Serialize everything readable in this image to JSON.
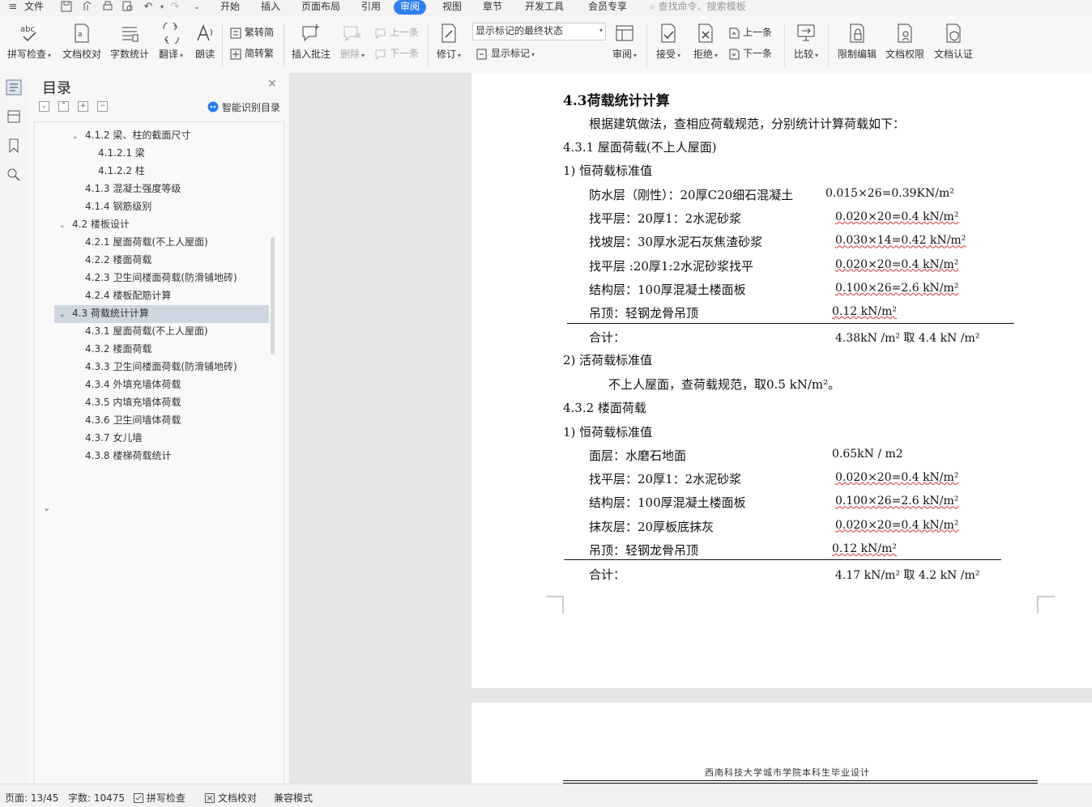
{
  "menu": {
    "file": "文件",
    "tabs": [
      "开始",
      "插入",
      "页面布局",
      "引用",
      "审阅",
      "视图",
      "章节",
      "开发工具",
      "会员专享"
    ],
    "active_tab": "审阅",
    "search_placeholder": "查找命令、搜索模板"
  },
  "ribbon": {
    "spell_check": "拼写检查",
    "doc_proof": "文档校对",
    "word_count": "字数统计",
    "translate": "翻译",
    "read_aloud": "朗读",
    "trad_to_simp": "繁转简",
    "simp_to_trad": "简转繁",
    "insert_comment": "插入批注",
    "delete": "删除",
    "prev_comment": "上一条",
    "next_comment": "下一条",
    "revise": "修订",
    "markup_mode": "显示标记的最终状态",
    "show_markup": "显示标记",
    "review": "审阅",
    "accept": "接受",
    "reject": "拒绝",
    "prev_change": "上一条",
    "next_change": "下一条",
    "compare": "比较",
    "restrict_edit": "限制编辑",
    "doc_permission": "文档权限",
    "doc_auth": "文档认证"
  },
  "toc": {
    "title": "目录",
    "smart_detect": "智能识别目录",
    "items": [
      {
        "label": "4.1.2  梁、柱的截面尺寸",
        "level": 2,
        "chevron": "⌄"
      },
      {
        "label": "4.1.2.1 梁",
        "level": 3
      },
      {
        "label": "4.1.2.2  柱",
        "level": 3
      },
      {
        "label": "4.1.3  混凝土强度等级",
        "level": 2
      },
      {
        "label": "4.1.4  钢筋级别",
        "level": 2
      },
      {
        "label": "4.2  楼板设计",
        "level": 1,
        "chevron": "⌄"
      },
      {
        "label": "4.2.1  屋面荷载(不上人屋面)",
        "level": 2
      },
      {
        "label": "4.2.2  楼面荷载",
        "level": 2
      },
      {
        "label": "4.2.3  卫生间楼面荷载(防滑铺地砖)",
        "level": 2
      },
      {
        "label": "4.2.4  楼板配筋计算",
        "level": 2
      },
      {
        "label": "4.3 荷载统计计算",
        "level": 1,
        "chevron": "⌄",
        "selected": true
      },
      {
        "label": "4.3.1  屋面荷载(不上人屋面)",
        "level": 2
      },
      {
        "label": "4.3.2  楼面荷载",
        "level": 2
      },
      {
        "label": "4.3.3  卫生间楼面荷载(防滑铺地砖)",
        "level": 2
      },
      {
        "label": "4.3.4  外填充墙体荷载",
        "level": 2
      },
      {
        "label": "4.3.5  内填充墙体荷载",
        "level": 2
      },
      {
        "label": "4.3.6  卫生间墙体荷载",
        "level": 2
      },
      {
        "label": "4.3.7  女儿墙",
        "level": 2
      },
      {
        "label": "4.3.8  楼梯荷载统计",
        "level": 2
      }
    ]
  },
  "document": {
    "heading": "4.3荷载统计计算",
    "intro": "根据建筑做法，查相应荷载规范，分别统计计算荷载如下：",
    "sec1_title": "4.3.1  屋面荷载(不上人屋面)",
    "sec1_dead_title": "1) 恒荷载标准值",
    "sec1_rows": [
      {
        "name": "防水层（刚性）：20厚C20细石混凝土",
        "value": "0.015×26=0.39KN/m²",
        "wavy": false
      },
      {
        "name": "找平层：20厚1：2水泥砂浆",
        "value": "0.020×20=0.4 kN/m²",
        "wavy": true
      },
      {
        "name": "找坡层：30厚水泥石灰焦渣砂浆",
        "value": "0.030×14=0.42 kN/m²",
        "wavy": true
      },
      {
        "name": "找平层 :20厚1:2水泥砂浆找平",
        "value": "0.020×20=0.4 kN/m²",
        "wavy": true
      },
      {
        "name": "结构层：100厚混凝土楼面板",
        "value": "0.100×26=2.6 kN/m²",
        "wavy": true
      },
      {
        "name": "吊顶：轻钢龙骨吊顶",
        "value": "0.12 kN/m²",
        "wavy": true
      }
    ],
    "sec1_total_label": "合计：",
    "sec1_total_value": "4.38kN /m²  取 4.4 kN /m²",
    "sec1_live_title": "2) 活荷载标准值",
    "sec1_live_text": "不上人屋面，查荷载规范，取0.5 kN/m²。",
    "sec2_title": "4.3.2  楼面荷载",
    "sec2_dead_title": "1) 恒荷载标准值",
    "sec2_rows": [
      {
        "name": "面层：水磨石地面",
        "value": "0.65kN / m2",
        "wavy": false
      },
      {
        "name": "找平层：20厚1：2水泥砂浆",
        "value": "0.020×20=0.4 kN/m²",
        "wavy": true
      },
      {
        "name": "结构层：100厚混凝土楼面板",
        "value": "0.100×26=2.6 kN/m²",
        "wavy": true
      },
      {
        "name": "抹灰层：20厚板底抹灰",
        "value": "0.020×20=0.4 kN/m²",
        "wavy": true
      },
      {
        "name": "吊顶：轻钢龙骨吊顶",
        "value": "0.12 kN/m²",
        "wavy": true
      }
    ],
    "sec2_total_label": "合计：",
    "sec2_total_value": "4.17  kN/m² 取 4.2 kN /m²",
    "page2_header": "西南科技大学城市学院本科生毕业设计"
  },
  "status": {
    "page": "页面: 13/45",
    "words": "字数: 10475",
    "spell": "拼写检查",
    "proof": "文档校对",
    "compat": "兼容模式"
  },
  "colors": {
    "accent": "#2f7ff0",
    "selected_row": "#cfd7e2",
    "spell_wave": "#e03030"
  }
}
